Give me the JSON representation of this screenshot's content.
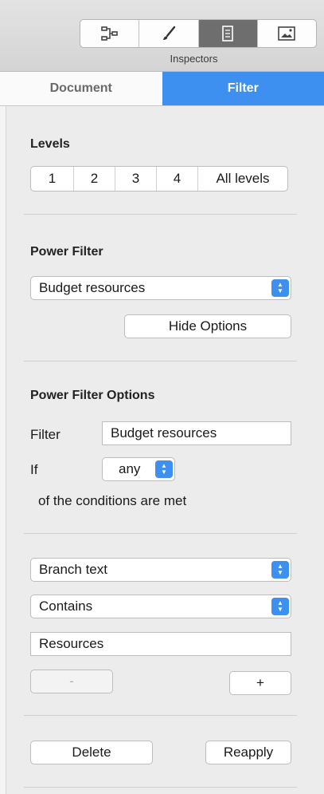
{
  "toolbar": {
    "segments": [
      {
        "icon": "outline-icon"
      },
      {
        "icon": "brush-icon"
      },
      {
        "icon": "document-icon"
      },
      {
        "icon": "image-icon"
      }
    ],
    "title": "Inspectors"
  },
  "tabs": [
    {
      "label": "Document"
    },
    {
      "label": "Filter"
    }
  ],
  "levels": {
    "heading": "Levels",
    "options": [
      "1",
      "2",
      "3",
      "4",
      "All levels"
    ]
  },
  "power_filter": {
    "heading": "Power Filter",
    "selected": "Budget resources",
    "hide_options_label": "Hide Options"
  },
  "power_filter_options": {
    "heading": "Power Filter Options",
    "filter_label": "Filter",
    "filter_value": "Budget resources",
    "if_label": "If",
    "match_value": "any",
    "conditions_text": "of the conditions are met"
  },
  "condition": {
    "field": "Branch text",
    "operator": "Contains",
    "value": "Resources",
    "remove_label": "-",
    "add_label": "+"
  },
  "actions": {
    "delete_label": "Delete",
    "reapply_label": "Reapply"
  },
  "colors": {
    "accent": "#3d8ff0",
    "active_segment": "#6e6e6e"
  }
}
